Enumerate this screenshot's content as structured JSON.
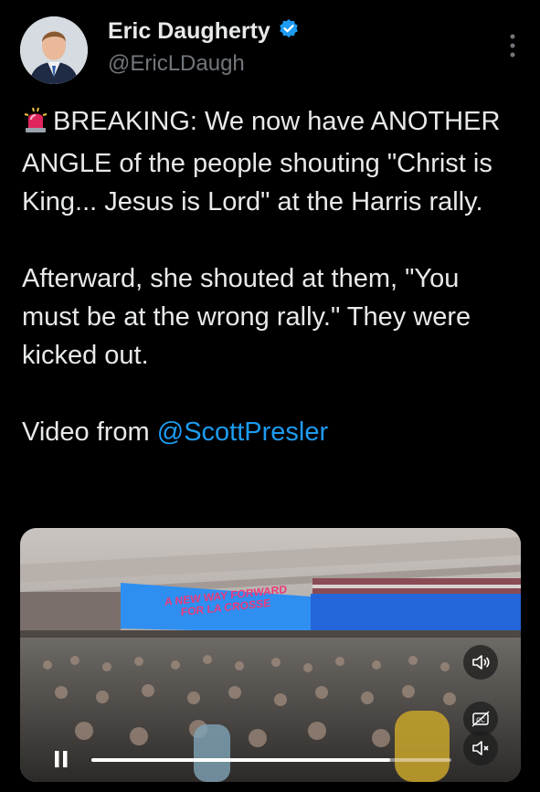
{
  "author": {
    "display_name": "Eric Daugherty",
    "handle": "@EricLDaugh",
    "verified": true
  },
  "tweet": {
    "paragraphs": [
      "BREAKING: We now have ANOTHER ANGLE of the people shouting \"Christ is King... Jesus is Lord\" at the Harris rally.",
      "Afterward, she shouted at them, \"You must be at the wrong rally.\" They were kicked out."
    ],
    "video_prefix": "Video from ",
    "mention": "@ScottPresler"
  },
  "video": {
    "banner_text": [
      "A NEW WAY FORWARD",
      "FOR LA CROSSE"
    ],
    "progress": 0.83,
    "state": "playing"
  },
  "icons": [
    "siren-emoji-icon",
    "verified-badge-icon",
    "more-options-icon",
    "pause-icon",
    "volume-icon",
    "captions-icon",
    "mute-icon"
  ],
  "colors": {
    "accent": "#1d9bf0",
    "background": "#000000",
    "text": "#e7e9ea",
    "muted": "#71767b"
  }
}
